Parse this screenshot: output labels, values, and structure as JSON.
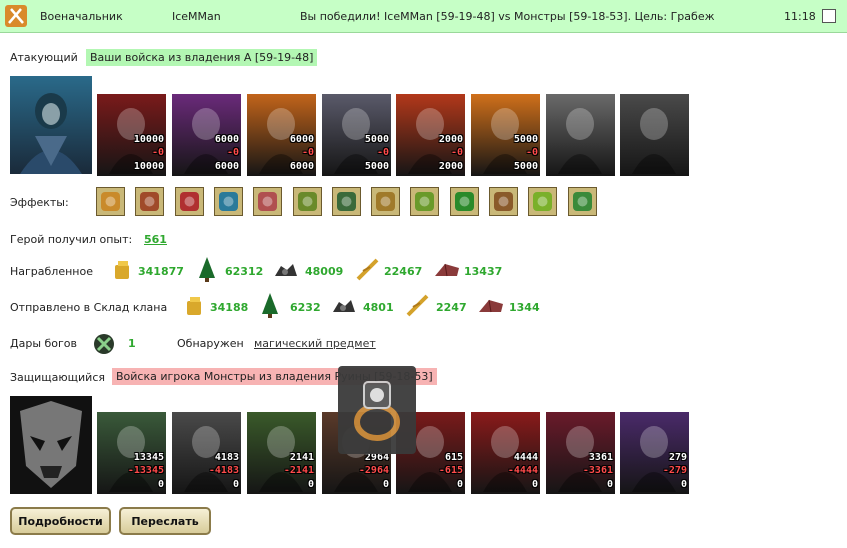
{
  "header": {
    "role": "Военачальник",
    "player": "IceMMan",
    "result": "Вы победили! IceMMan [59-19-48] vs Монстры [59-18-53]. Цель: Грабеж",
    "time": "11:18"
  },
  "attacker": {
    "label": "Атакующий",
    "banner": "Ваши войска из владения А [59-19-48]",
    "units": [
      {
        "count": "10000",
        "loss": "-0",
        "remain": "10000",
        "color": "#7a1a1a"
      },
      {
        "count": "6000",
        "loss": "-0",
        "remain": "6000",
        "color": "#6a2a7a"
      },
      {
        "count": "6000",
        "loss": "-0",
        "remain": "6000",
        "color": "#c2641a"
      },
      {
        "count": "5000",
        "loss": "-0",
        "remain": "5000",
        "color": "#5a5a6a"
      },
      {
        "count": "2000",
        "loss": "-0",
        "remain": "2000",
        "color": "#b3381a"
      },
      {
        "count": "5000",
        "loss": "-0",
        "remain": "5000",
        "color": "#d0701a"
      },
      {
        "count": "",
        "loss": "",
        "remain": "",
        "color": "#6a6a6a"
      },
      {
        "count": "",
        "loss": "",
        "remain": "",
        "color": "#4a4a4a"
      }
    ]
  },
  "effects": {
    "label": "Эффекты:",
    "icons": [
      "coins-effect-icon",
      "chest-effect-icon",
      "dice-effect-icon",
      "shield-effect-icon",
      "hand-effect-icon",
      "armor-effect-icon",
      "potion-effect-icon",
      "bag-effect-icon",
      "ring-effect-icon",
      "clover-effect-icon",
      "bow-effect-icon",
      "clover-gold-effect-icon",
      "xp-effect-icon"
    ]
  },
  "experience": {
    "label": "Герой получил опыт:",
    "value": "561"
  },
  "loot": {
    "label": "Награбленное",
    "gold": "341877",
    "wood": "62312",
    "ore": "48009",
    "grain": "22467",
    "stone": "13437"
  },
  "clan": {
    "label": "Отправлено в Склад клана",
    "gold": "34188",
    "wood": "6232",
    "ore": "4801",
    "grain": "2247",
    "stone": "1344"
  },
  "gifts": {
    "label": "Дары богов",
    "value": "1",
    "found_label": "Обнаружен",
    "found_link": "магический предмет"
  },
  "defender": {
    "label": "Защищающийся",
    "banner": "Войска игрока Монстры из владения Руины [59-18-53]",
    "units": [
      {
        "count": "13345",
        "loss": "-13345",
        "remain": "0",
        "color": "#3a5a3a"
      },
      {
        "count": "4183",
        "loss": "-4183",
        "remain": "0",
        "color": "#4a4a4a"
      },
      {
        "count": "2141",
        "loss": "-2141",
        "remain": "0",
        "color": "#3a5a2a"
      },
      {
        "count": "2964",
        "loss": "-2964",
        "remain": "0",
        "color": "#5a3a2a"
      },
      {
        "count": "615",
        "loss": "-615",
        "remain": "0",
        "color": "#7a1a1a"
      },
      {
        "count": "4444",
        "loss": "-4444",
        "remain": "0",
        "color": "#8a1a1a"
      },
      {
        "count": "3361",
        "loss": "-3361",
        "remain": "0",
        "color": "#6a1a2a"
      },
      {
        "count": "279",
        "loss": "-279",
        "remain": "0",
        "color": "#4a2a6a"
      }
    ]
  },
  "buttons": {
    "details": "Подробности",
    "forward": "Переслать"
  }
}
